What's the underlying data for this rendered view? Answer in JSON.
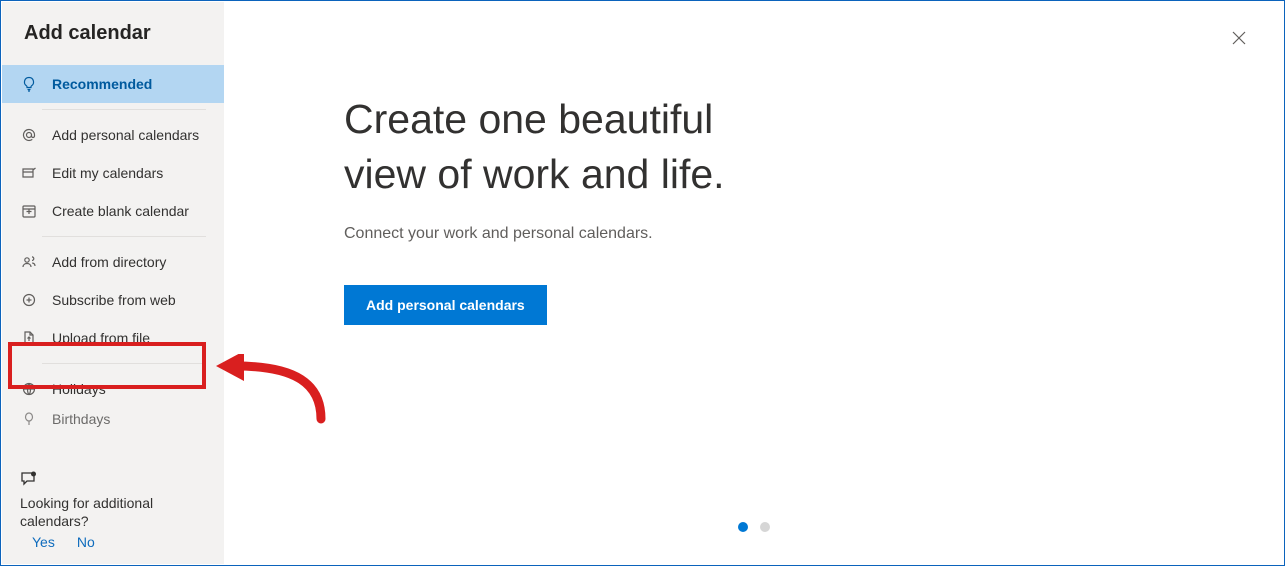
{
  "dialog_title": "Add calendar",
  "sidebar": {
    "items": [
      {
        "label": "Recommended",
        "icon": "lightbulb",
        "selected": true
      },
      {
        "label": "Add personal calendars",
        "icon": "mention"
      },
      {
        "label": "Edit my calendars",
        "icon": "edit"
      },
      {
        "label": "Create blank calendar",
        "icon": "add-square"
      },
      {
        "label": "Add from directory",
        "icon": "people"
      },
      {
        "label": "Subscribe from web",
        "icon": "subscribe"
      },
      {
        "label": "Upload from file",
        "icon": "file-upload"
      },
      {
        "label": "Holidays",
        "icon": "globe"
      },
      {
        "label": "Birthdays",
        "icon": "balloon"
      }
    ]
  },
  "main": {
    "heading_line1": "Create one beautiful",
    "heading_line2": "view of work and life.",
    "subheading": "Connect your work and personal calendars.",
    "cta_label": "Add personal calendars"
  },
  "footer": {
    "question": "Looking for additional calendars?",
    "yes": "Yes",
    "no": "No"
  },
  "pager": {
    "active": 0,
    "count": 2
  },
  "colors": {
    "accent": "#0078d4",
    "annotation": "#d91f1f"
  }
}
